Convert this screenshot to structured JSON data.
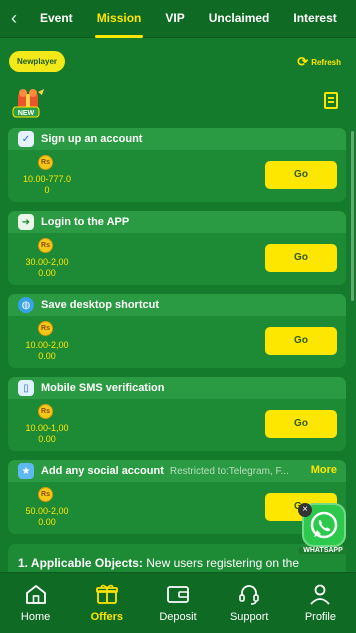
{
  "tabs": [
    {
      "label": "Event"
    },
    {
      "label": "Mission",
      "active": true
    },
    {
      "label": "VIP"
    },
    {
      "label": "Unclaimed"
    },
    {
      "label": "Interest"
    }
  ],
  "header": {
    "newplayer_label": "Newplayer",
    "refresh_label": "Refresh",
    "new_badge_text": "NEW"
  },
  "tasks": [
    {
      "title": "Sign up an account",
      "note": "",
      "more": "",
      "currency": "Rs",
      "reward": "10.00-777.0\n0",
      "button": "Go",
      "icon": "phone-check-icon"
    },
    {
      "title": "Login to the APP",
      "note": "",
      "more": "",
      "currency": "Rs",
      "reward": "30.00-2,00\n0.00",
      "button": "Go",
      "icon": "app-login-icon"
    },
    {
      "title": "Save desktop shortcut",
      "note": "",
      "more": "",
      "currency": "Rs",
      "reward": "10.00-2,00\n0.00",
      "button": "Go",
      "icon": "globe-icon"
    },
    {
      "title": "Mobile SMS verification",
      "note": "",
      "more": "",
      "currency": "Rs",
      "reward": "10.00-1,00\n0.00",
      "button": "Go",
      "icon": "mobile-icon"
    },
    {
      "title": "Add any social account",
      "note": "Restricted to:Telegram, F...",
      "more": "More",
      "currency": "Rs",
      "reward": "50.00-2,00\n0.00",
      "button": "Go",
      "icon": "star-icon"
    }
  ],
  "rules": {
    "heading": "1. Applicable Objects:",
    "text": "New users registering on the"
  },
  "whatsapp": {
    "label": "WHATSAPP"
  },
  "nav": [
    {
      "label": "Home",
      "icon": "home-icon"
    },
    {
      "label": "Offers",
      "icon": "offers-icon",
      "active": true
    },
    {
      "label": "Deposit",
      "icon": "deposit-icon"
    },
    {
      "label": "Support",
      "icon": "support-icon"
    },
    {
      "label": "Profile",
      "icon": "profile-icon"
    }
  ],
  "colors": {
    "background": "#147a2c",
    "accent": "#ffe600",
    "card": "#1d8a36",
    "button": "#fde600"
  }
}
